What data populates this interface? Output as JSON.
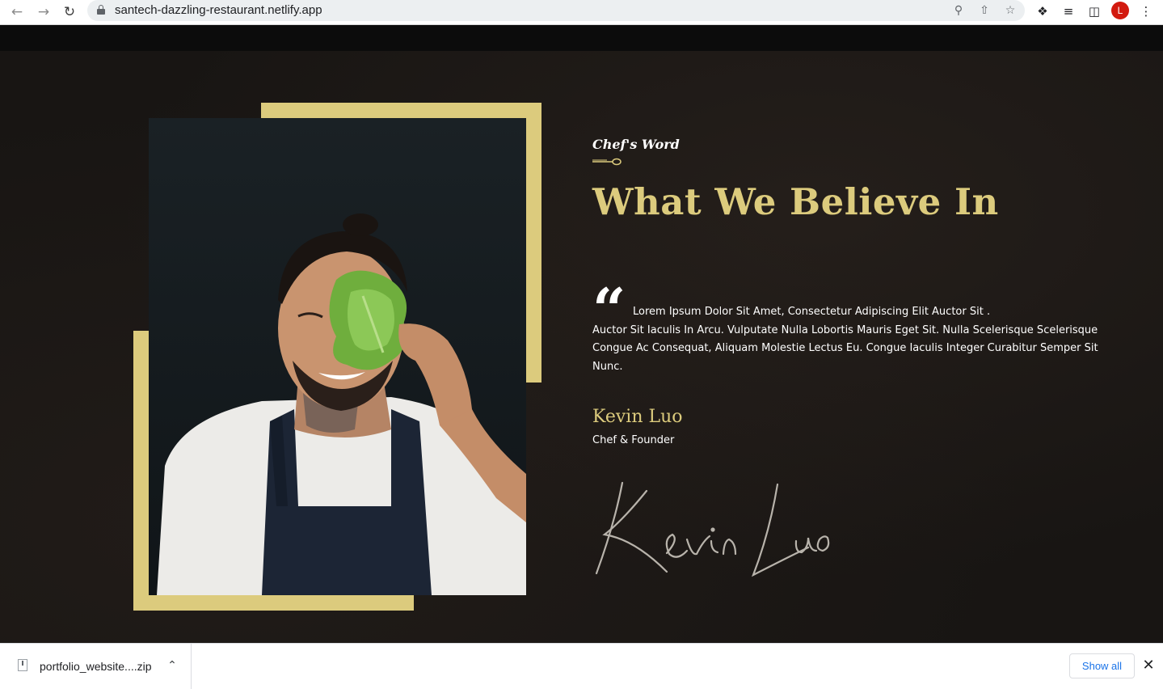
{
  "browser": {
    "url": "santech-dazzling-restaurant.netlify.app",
    "profile_initial": "L",
    "icons": {
      "back": "back-arrow-icon",
      "forward": "forward-arrow-icon",
      "reload": "reload-icon",
      "lock": "lock-icon",
      "zoom": "zoom-icon",
      "share": "share-icon",
      "bookmark": "star-icon",
      "extensions": "puzzle-icon",
      "media": "media-queue-icon",
      "sidepanel": "side-panel-icon",
      "menu": "kebab-menu-icon"
    }
  },
  "section": {
    "eyebrow": "Chef's Word",
    "heading": "What We Believe In",
    "quote_first_line": "Lorem Ipsum Dolor Sit Amet, Consectetur Adipiscing Elit Auctor Sit .",
    "quote_rest": "Auctor Sit Iaculis In Arcu. Vulputate Nulla Lobortis Mauris Eget Sit. Nulla Scelerisque Scelerisque Congue Ac Consequat, Aliquam Molestie Lectus Eu. Congue Iaculis Integer Curabitur Semper Sit Nunc.",
    "author_name": "Kevin Luo",
    "author_role": "Chef & Founder",
    "signature_text": "Kevin Luo",
    "photo": "chef-holding-lettuce-photo"
  },
  "colors": {
    "accent": "#dccb7d",
    "background": "#181513",
    "text": "#ffffff"
  },
  "downloads": {
    "file_name": "portfolio_website....zip",
    "show_all_label": "Show all"
  }
}
